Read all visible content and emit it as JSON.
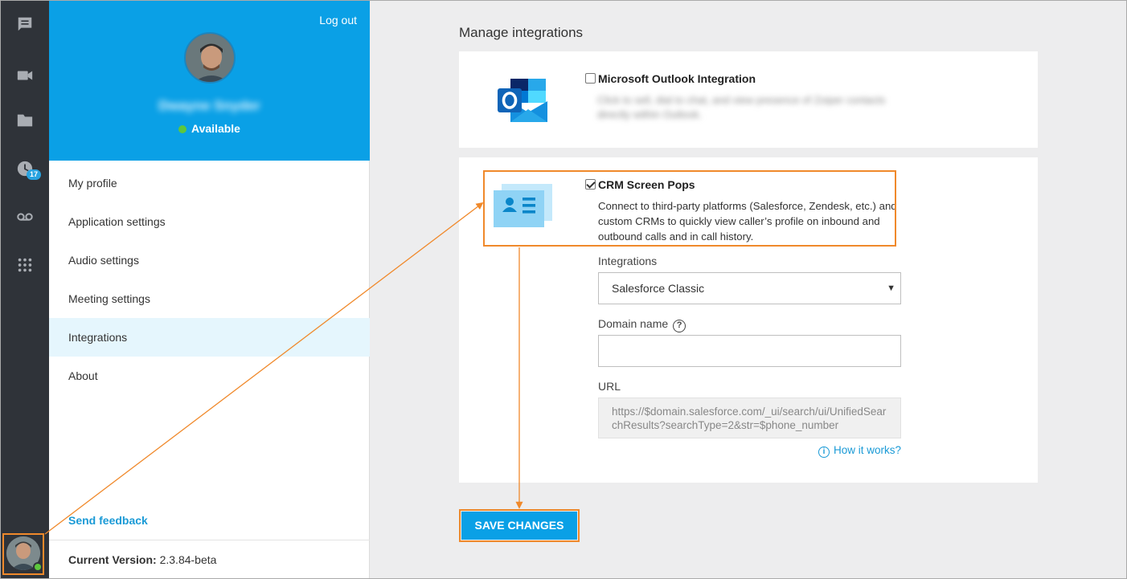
{
  "rail": {
    "icons": [
      "chat-icon",
      "video-icon",
      "folder-icon",
      "history-icon",
      "voicemail-icon",
      "dialpad-icon"
    ],
    "history_badge": "17"
  },
  "profile": {
    "logout": "Log out",
    "name": "Dwayne Snyder",
    "status": "Available",
    "status_color": "#5dc73d"
  },
  "menu": {
    "items": [
      {
        "label": "My profile"
      },
      {
        "label": "Application settings"
      },
      {
        "label": "Audio settings"
      },
      {
        "label": "Meeting settings"
      },
      {
        "label": "Integrations"
      },
      {
        "label": "About"
      }
    ],
    "active": "Integrations",
    "feedback": "Send feedback",
    "version_label": "Current Version:",
    "version_value": "2.3.84-beta"
  },
  "main": {
    "title": "Manage integrations",
    "outlook": {
      "title": "Microsoft Outlook Integration",
      "checked": false,
      "description": "Click to sell, dial to chat, and view presence of Zoiper contacts directly within Outlook."
    },
    "crm": {
      "title": "CRM Screen Pops",
      "checked": true,
      "description": "Connect to third-party platforms (Salesforce, Zendesk, etc.) and custom CRMs to quickly view caller’s profile on inbound and outbound calls and in call history.",
      "integrations_label": "Integrations",
      "integrations_value": "Salesforce Classic",
      "domain_label": "Domain name",
      "domain_value": "",
      "url_label": "URL",
      "url_value": "https://$domain.salesforce.com/_ui/search/ui/UnifiedSearchResults?searchType=2&str=$phone_number",
      "how_it_works": "How it works?"
    },
    "save_label": "SAVE CHANGES"
  },
  "colors": {
    "accent": "#0aa0e6",
    "highlight": "#f0892b",
    "rail": "#2f3339"
  }
}
